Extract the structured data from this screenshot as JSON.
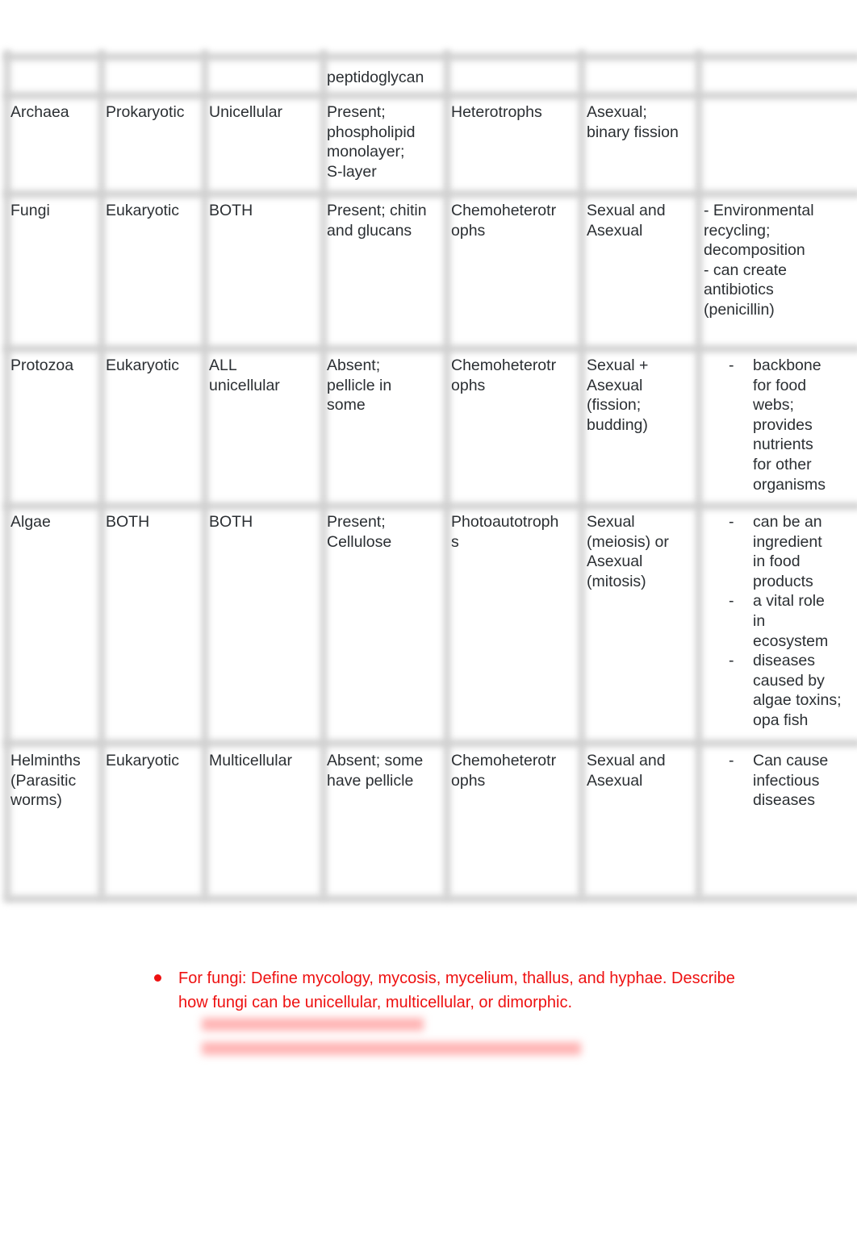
{
  "table": {
    "rows": [
      {
        "cells": [
          "",
          "",
          "",
          "peptidoglycan",
          "",
          "",
          ""
        ]
      },
      {
        "cells": [
          "Archaea",
          "Prokaryotic",
          "Unicellular",
          "Present;\nphospholipid\nmonolayer;\nS-layer",
          "Heterotrophs",
          "Asexual;\nbinary fission",
          ""
        ]
      },
      {
        "cells": [
          "Fungi",
          "Eukaryotic",
          "BOTH",
          "Present; chitin\nand glucans",
          "Chemoheterotr\nophs",
          "Sexual and\nAsexual",
          "- Environmental\nrecycling;\ndecomposition\n- can create\nantibiotics\n(penicillin)"
        ]
      },
      {
        "cells": [
          "Protozoa",
          "Eukaryotic",
          "ALL\nunicellular",
          "Absent;\npellicle in\nsome",
          "Chemoheterotr\nophs",
          "Sexual +\nAsexual\n(fission;\nbudding)",
          ""
        ],
        "list": [
          "backbone\nfor food\nwebs;\nprovides\nnutrients\nfor other\norganisms"
        ]
      },
      {
        "cells": [
          "Algae",
          "BOTH",
          "BOTH",
          "Present;\nCellulose",
          "Photoautotroph\ns",
          "Sexual\n(meiosis) or\nAsexual\n(mitosis)",
          ""
        ],
        "list": [
          "can be an\ningredient\nin food\nproducts",
          " a vital role\nin\necosystem",
          " diseases\ncaused by\nalgae toxins;\nopa fish"
        ]
      },
      {
        "cells": [
          "Helminths\n(Parasitic\nworms)",
          "Eukaryotic",
          "Multicellular",
          "Absent; some\nhave pellicle",
          "Chemoheterotr\nophs",
          "Sexual and\nAsexual",
          ""
        ],
        "list": [
          "Can cause\ninfectious\ndiseases"
        ]
      }
    ],
    "list_marker": "-"
  },
  "notes": {
    "bullet_text": "For fungi: Define mycology, mycosis, mycelium, thallus, and hyphae. Describe how fungi can be unicellular, multicellular, or dimorphic.",
    "accent_color": "#ee1111"
  }
}
